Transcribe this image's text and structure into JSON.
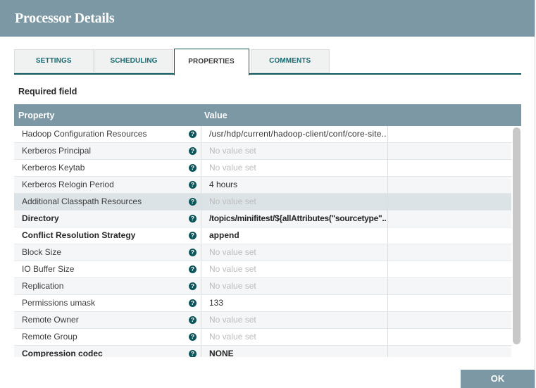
{
  "colors": {
    "slate": "#7D98A5",
    "tealdark": "#0C565C",
    "tealtext": "#19696F",
    "selrow": "#DCE3E6",
    "altrow": "#F4F6F7",
    "novalue": "#BCBCBC"
  },
  "dialog": {
    "title": "Processor Details"
  },
  "tabs": [
    {
      "label": "SETTINGS",
      "active": false
    },
    {
      "label": "SCHEDULING",
      "active": false
    },
    {
      "label": "PROPERTIES",
      "active": true
    },
    {
      "label": "COMMENTS",
      "active": false
    }
  ],
  "required_field_label": "Required field",
  "icons": {
    "help": "?"
  },
  "table": {
    "columns": [
      "Property",
      "Value"
    ],
    "rows": [
      {
        "property": "Hadoop Configuration Resources",
        "value": "/usr/hdp/current/hadoop-client/conf/core-site..",
        "required": false,
        "no_value": false,
        "selected": false
      },
      {
        "property": "Kerberos Principal",
        "value": "No value set",
        "required": false,
        "no_value": true,
        "selected": false
      },
      {
        "property": "Kerberos Keytab",
        "value": "No value set",
        "required": false,
        "no_value": true,
        "selected": false
      },
      {
        "property": "Kerberos Relogin Period",
        "value": "4 hours",
        "required": false,
        "no_value": false,
        "selected": false
      },
      {
        "property": "Additional Classpath Resources",
        "value": "No value set",
        "required": false,
        "no_value": true,
        "selected": true
      },
      {
        "property": "Directory",
        "value": "/topics/minifitest/${allAttributes(\"sourcetype\"..",
        "required": true,
        "no_value": false,
        "selected": false
      },
      {
        "property": "Conflict Resolution Strategy",
        "value": "append",
        "required": true,
        "no_value": false,
        "selected": false
      },
      {
        "property": "Block Size",
        "value": "No value set",
        "required": false,
        "no_value": true,
        "selected": false
      },
      {
        "property": "IO Buffer Size",
        "value": "No value set",
        "required": false,
        "no_value": true,
        "selected": false
      },
      {
        "property": "Replication",
        "value": "No value set",
        "required": false,
        "no_value": true,
        "selected": false
      },
      {
        "property": "Permissions umask",
        "value": "133",
        "required": false,
        "no_value": false,
        "selected": false
      },
      {
        "property": "Remote Owner",
        "value": "No value set",
        "required": false,
        "no_value": true,
        "selected": false
      },
      {
        "property": "Remote Group",
        "value": "No value set",
        "required": false,
        "no_value": true,
        "selected": false
      },
      {
        "property": "Compression codec",
        "value": "NONE",
        "required": true,
        "no_value": false,
        "selected": false
      }
    ]
  },
  "footer": {
    "ok_label": "OK"
  }
}
